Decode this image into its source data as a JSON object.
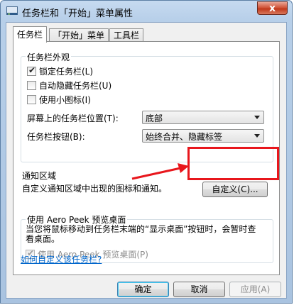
{
  "window": {
    "title": "任务栏和「开始」菜单属性",
    "close_label": "x"
  },
  "tabs": [
    {
      "label": "任务栏",
      "active": true
    },
    {
      "label": "「开始」菜单",
      "active": false
    },
    {
      "label": "工具栏",
      "active": false
    }
  ],
  "appearance": {
    "title": "任务栏外观",
    "checkboxes": [
      {
        "label": "锁定任务栏(L)",
        "checked": true
      },
      {
        "label": "自动隐藏任务栏(U)",
        "checked": false
      },
      {
        "label": "使用小图标(I)",
        "checked": false
      }
    ],
    "position_label": "屏幕上的任务栏位置(T):",
    "position_value": "底部",
    "buttons_label": "任务栏按钮(B):",
    "buttons_value": "始终合并、隐藏标签"
  },
  "notification": {
    "title": "通知区域",
    "description": "自定义通知区域中出现的图标和通知。",
    "customize_button": "自定义(C)..."
  },
  "aero_peek": {
    "title": "使用 Aero Peek 预览桌面",
    "description": "当您将鼠标移动到任务栏末端的“显示桌面”按钮时，会暂时查看桌面。",
    "checkbox_label": "使用 Aero Peek 预览桌面(P)",
    "checkbox_checked": true,
    "checkbox_disabled": true
  },
  "help_link": "如何自定义该任务栏?",
  "footer": {
    "ok": "确定",
    "cancel": "取消",
    "apply": "应用(A)"
  },
  "colors": {
    "accent_highlight": "#e8161c",
    "link": "#0066cc"
  }
}
